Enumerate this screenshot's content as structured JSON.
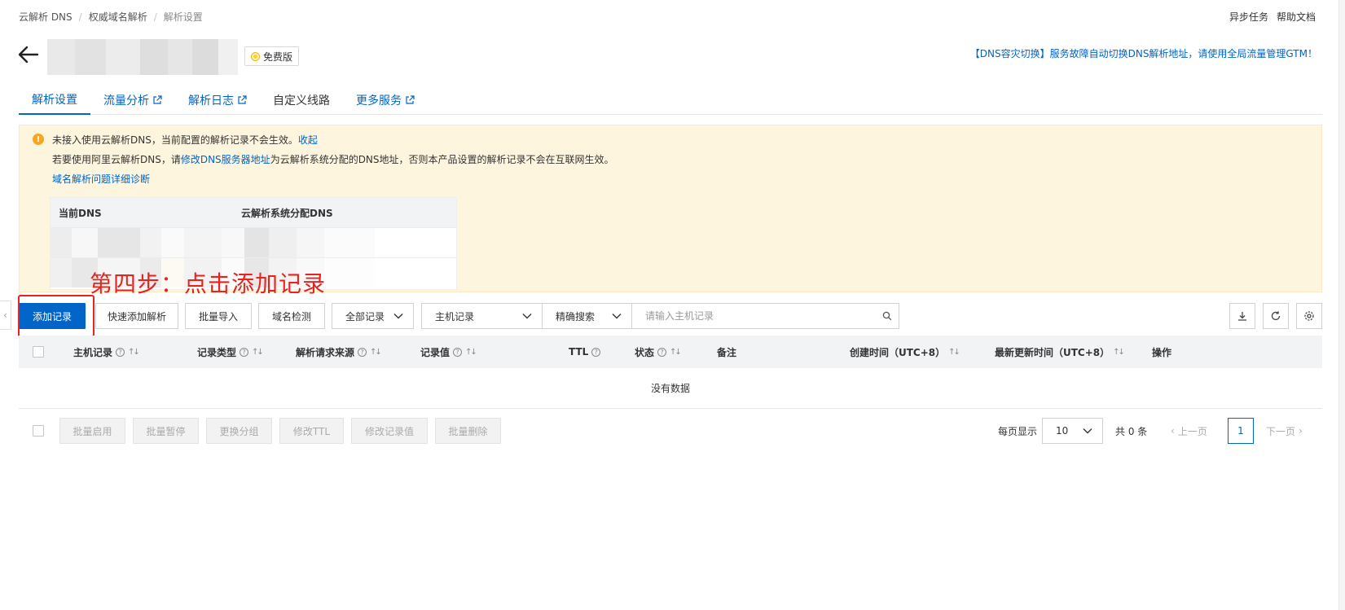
{
  "breadcrumb": [
    "云解析 DNS",
    "权威域名解析",
    "解析设置"
  ],
  "top_links": {
    "async_tasks": "异步任务",
    "help_docs": "帮助文档"
  },
  "header": {
    "badge": "免费版",
    "gtm_notice": "【DNS容灾切换】服务故障自动切换DNS解析地址，请使用全局流量管理GTM！"
  },
  "tabs": [
    {
      "label": "解析设置",
      "active": true,
      "external": false
    },
    {
      "label": "流量分析",
      "active": false,
      "external": true
    },
    {
      "label": "解析日志",
      "active": false,
      "external": true
    },
    {
      "label": "自定义线路",
      "active": false,
      "external": false
    },
    {
      "label": "更多服务",
      "active": false,
      "external": true
    }
  ],
  "notice": {
    "line1": "未接入使用云解析DNS，当前配置的解析记录不会生效。",
    "collapse": "收起",
    "line2_prefix": "若要使用阿里云解析DNS，请",
    "line2_link": "修改DNS服务器地址",
    "line2_suffix": "为云解析系统分配的DNS地址，否则本产品设置的解析记录不会在互联网生效。",
    "diagnose": "域名解析问题详细诊断",
    "table_headers": {
      "current": "当前DNS",
      "assigned": "云解析系统分配DNS"
    }
  },
  "annotation": "第四步：点击添加记录",
  "toolbar": {
    "add": "添加记录",
    "quick_add": "快速添加解析",
    "import": "批量导入",
    "detect": "域名检测",
    "filter_all": "全部记录",
    "field_select": "主机记录",
    "match_select": "精确搜索",
    "search_placeholder": "请输入主机记录"
  },
  "table": {
    "columns": {
      "host": "主机记录",
      "type": "记录类型",
      "source": "解析请求来源",
      "value": "记录值",
      "ttl": "TTL",
      "status": "状态",
      "remark": "备注",
      "created": "创建时间（UTC+8）",
      "updated": "最新更新时间（UTC+8）",
      "actions": "操作"
    },
    "empty": "没有数据"
  },
  "footer": {
    "enable": "批量启用",
    "pause": "批量暂停",
    "group": "更换分组",
    "ttl": "修改TTL",
    "value": "修改记录值",
    "delete": "批量删除",
    "per_page_label": "每页显示",
    "per_page": "10",
    "total": "共 0 条",
    "prev": "上一页",
    "page": "1",
    "next": "下一页"
  },
  "colors": {
    "primary": "#0064c8",
    "annotation": "#e8231d",
    "notice_bg": "#fdf5de",
    "warn": "#f5a623"
  }
}
